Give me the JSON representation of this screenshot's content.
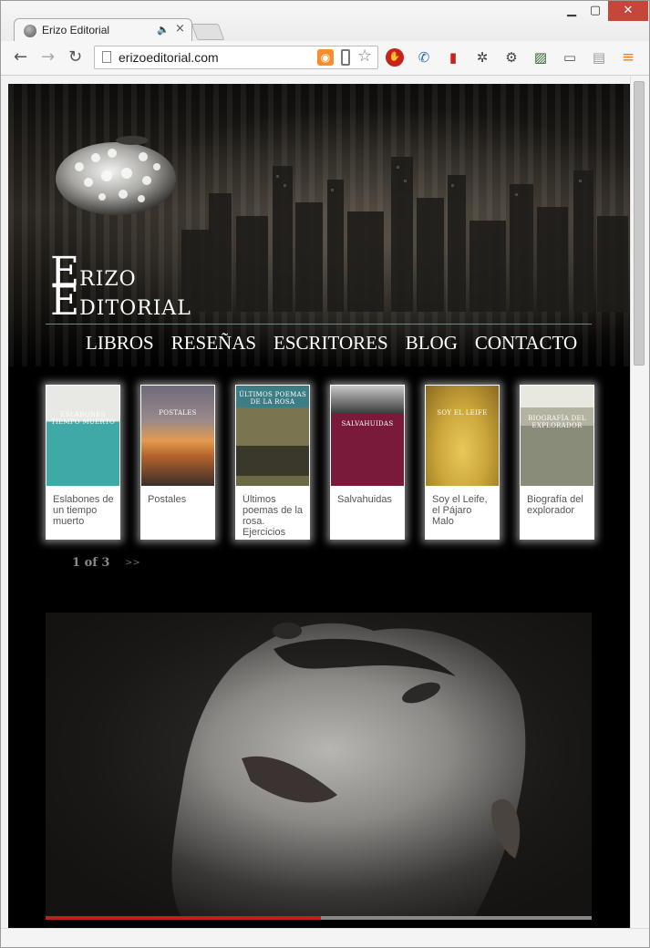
{
  "browser": {
    "tab_title": "Erizo Editorial",
    "url": "erizoeditorial.com"
  },
  "site": {
    "logo": {
      "line1_initial": "E",
      "line1_rest": "RIZO",
      "line2_initial": "E",
      "line2_rest": "DITORIAL"
    },
    "nav": [
      "LIBROS",
      "RESEÑAS",
      "ESCRITORES",
      "BLOG",
      "CONTACTO"
    ],
    "books": [
      {
        "title": "Eslabones de un tiempo muerto",
        "cover_text": "ESLABONES TIEMPO MUERTO",
        "cover_color": "#3fa9a8"
      },
      {
        "title": "Postales",
        "cover_text": "POSTALES",
        "cover_color": "#d47a3a"
      },
      {
        "title": "Últimos poemas de la rosa. Ejercicios",
        "cover_text": "ÚLTIMOS POEMAS DE LA ROSA",
        "cover_color": "#6b6a44"
      },
      {
        "title": "Salvahuidas",
        "cover_text": "SALVAHUIDAS",
        "cover_color": "#7a1a3a"
      },
      {
        "title": "Soy el Leife, el Pájaro Malo",
        "cover_text": "SOY EL LEIFE",
        "cover_color": "#c9a43a"
      },
      {
        "title": "Biografía del explorador",
        "cover_text": "BIOGRAFÍA DEL EXPLORADOR",
        "cover_color": "#8a8c7a"
      }
    ],
    "pager": {
      "current": "1 of 3",
      "next": ">>"
    },
    "slider_progress": 0.505
  },
  "colors": {
    "nav_text": "#ffffff",
    "divider": "#6a8a8e",
    "slider_accent": "#c0201d"
  }
}
